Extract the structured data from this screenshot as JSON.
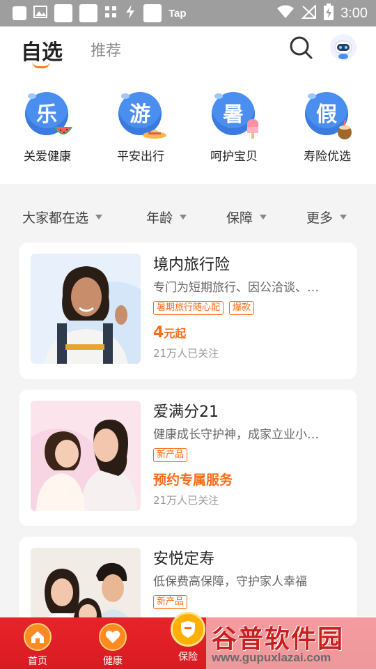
{
  "status_bar": {
    "app_label": "Tap",
    "time": "3:00"
  },
  "header": {
    "tab_active": "自选",
    "tab_inactive": "推荐",
    "icons": {
      "search": "search-icon",
      "avatar": "robot-avatar"
    }
  },
  "categories": [
    {
      "char": "乐",
      "label": "关爱健康",
      "deco": "watermelon"
    },
    {
      "char": "游",
      "label": "平安出行",
      "deco": "sun-hat"
    },
    {
      "char": "暑",
      "label": "呵护宝贝",
      "deco": "popsicle"
    },
    {
      "char": "假",
      "label": "寿险优选",
      "deco": "coconut-drink"
    }
  ],
  "filters": [
    "大家都在选",
    "年龄",
    "保障",
    "更多"
  ],
  "products": [
    {
      "title": "境内旅行险",
      "desc": "专门为短期旅行、因公洽谈、…",
      "tags": [
        "暑期旅行随心配",
        "爆款"
      ],
      "price_num": "4",
      "price_unit": "元起",
      "price_text": "",
      "followers": "21万人已关注"
    },
    {
      "title": "爱满分21",
      "desc": "健康成长守护神，成家立业小…",
      "tags": [
        "新产品"
      ],
      "price_num": "",
      "price_unit": "",
      "price_text": "预约专属服务",
      "followers": "21万人已关注"
    },
    {
      "title": "安悦定寿",
      "desc": "低保费高保障，守护家人幸福",
      "tags": [
        "新产品"
      ],
      "price_num": "",
      "price_unit": "",
      "price_text": "",
      "followers": ""
    }
  ],
  "bottom_nav": [
    {
      "label": "首页",
      "icon": "home-icon"
    },
    {
      "label": "健康",
      "icon": "heart-icon"
    },
    {
      "label": "保险",
      "icon": "shield-icon",
      "active": true
    }
  ],
  "watermark": {
    "logo": "谷普软件园",
    "url": "www.gupuxlazai.com"
  },
  "colors": {
    "accent": "#ff6a13",
    "nav_red": "#e8232a",
    "badge_blue": "#4a8ef0"
  }
}
